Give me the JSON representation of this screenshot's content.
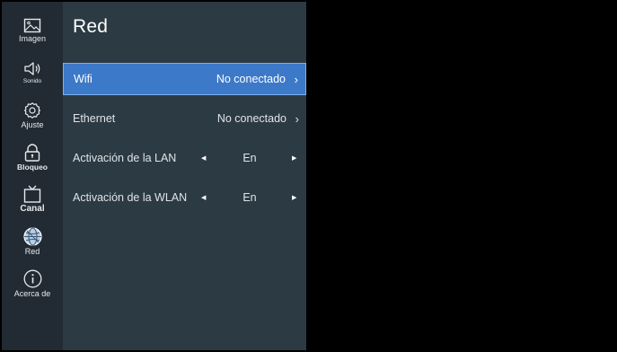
{
  "sidebar": {
    "items": [
      {
        "label": "Imagen",
        "icon": "image-icon"
      },
      {
        "label": "Sonido",
        "icon": "speaker-icon"
      },
      {
        "label": "Ajuste",
        "icon": "gear-icon"
      },
      {
        "label": "Bloqueo",
        "icon": "lock-icon"
      },
      {
        "label": "Canal",
        "icon": "tv-icon"
      },
      {
        "label": "Red",
        "icon": "globe-icon"
      },
      {
        "label": "Acerca de",
        "icon": "info-icon"
      }
    ],
    "active": "Red"
  },
  "panel": {
    "title": "Red",
    "rows": [
      {
        "label": "Wifi",
        "value": "No conectado",
        "selected": true
      },
      {
        "label": "Ethernet",
        "value": "No conectado"
      },
      {
        "label": "Activación de la LAN",
        "value": "En"
      },
      {
        "label": "Activación de la WLAN",
        "value": "En"
      }
    ]
  },
  "colors": {
    "sidebar_bg": "#222b33",
    "panel_bg": "#2c3a43",
    "highlight": "#3d79c9",
    "screen_bg": "#000000"
  }
}
